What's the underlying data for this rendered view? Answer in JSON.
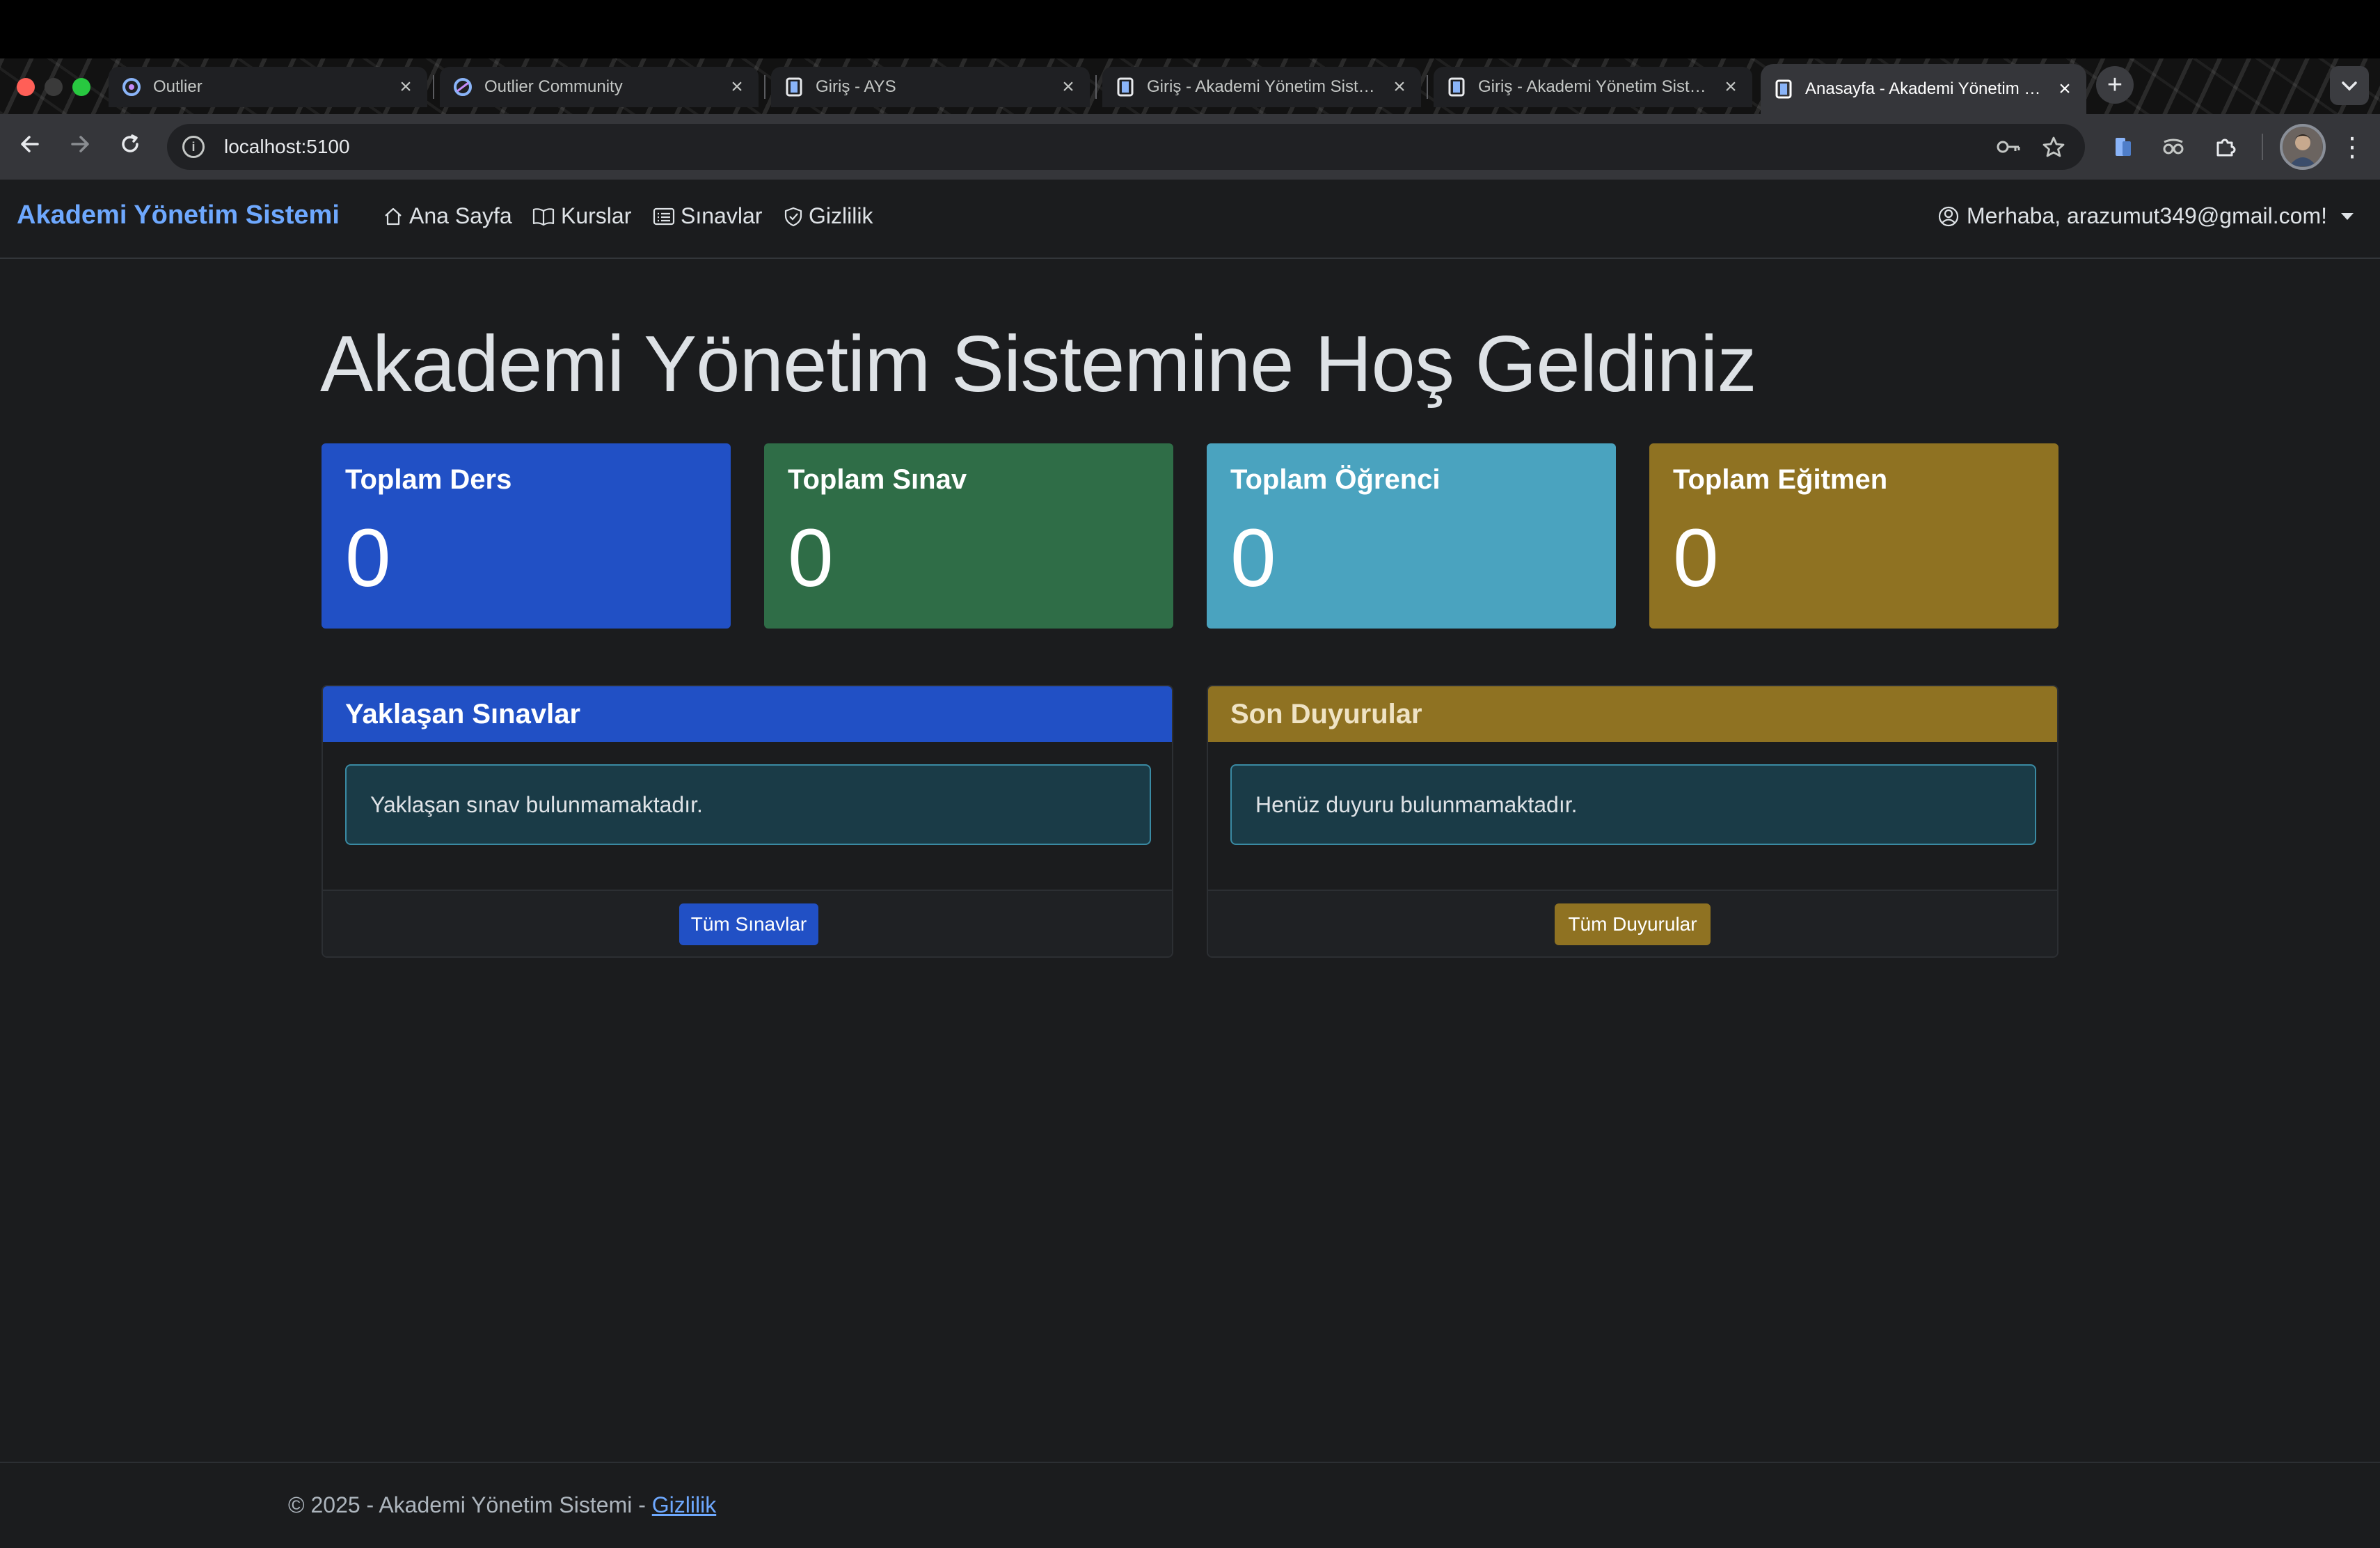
{
  "browser": {
    "tabs": [
      {
        "title": "Outlier",
        "favicon": "outlier-icon",
        "active": false
      },
      {
        "title": "Outlier Community",
        "favicon": "outlier-community-icon",
        "active": false
      },
      {
        "title": "Giriş - AYS",
        "favicon": "document-icon",
        "active": false
      },
      {
        "title": "Giriş - Akademi Yönetim Sistemi",
        "favicon": "document-icon",
        "active": false
      },
      {
        "title": "Giriş - Akademi Yönetim Sistemi",
        "favicon": "document-icon",
        "active": false
      },
      {
        "title": "Anasayfa - Akademi Yönetim Sistemi",
        "favicon": "document-icon",
        "active": true
      }
    ],
    "new_tab_label": "+",
    "url": "localhost:5100"
  },
  "navbar": {
    "brand": "Akademi Yönetim Sistemi",
    "links": [
      {
        "label": "Ana Sayfa",
        "icon": "house-icon"
      },
      {
        "label": "Kurslar",
        "icon": "book-icon"
      },
      {
        "label": "Sınavlar",
        "icon": "card-list-icon"
      },
      {
        "label": "Gizlilik",
        "icon": "shield-icon"
      }
    ],
    "user_greeting": "Merhaba, arazumut349@gmail.com!"
  },
  "main": {
    "headline": "Akademi Yönetim Sistemine Hoş Geldiniz",
    "stats": [
      {
        "title": "Toplam Ders",
        "value": "0",
        "color": "#2150c5"
      },
      {
        "title": "Toplam Sınav",
        "value": "0",
        "color": "#2f6d47"
      },
      {
        "title": "Toplam Öğrenci",
        "value": "0",
        "color": "#4aa3bf"
      },
      {
        "title": "Toplam Eğitmen",
        "value": "0",
        "color": "#8f7222"
      }
    ],
    "upcoming_exams": {
      "title": "Yaklaşan Sınavlar",
      "empty_message": "Yaklaşan sınav bulunmamaktadır.",
      "button_label": "Tüm Sınavlar"
    },
    "announcements": {
      "title": "Son Duyurular",
      "empty_message": "Henüz duyuru bulunmamaktadır.",
      "button_label": "Tüm Duyurular"
    }
  },
  "footer": {
    "text": "© 2025 - Akademi Yönetim Sistemi - ",
    "privacy_link": "Gizlilik"
  },
  "colors": {
    "brand": "#6ea8fe",
    "page_bg": "#1b1c1e",
    "primary": "#2150c5",
    "warning": "#8f7222",
    "info_alert_bg": "#1a3b47"
  }
}
